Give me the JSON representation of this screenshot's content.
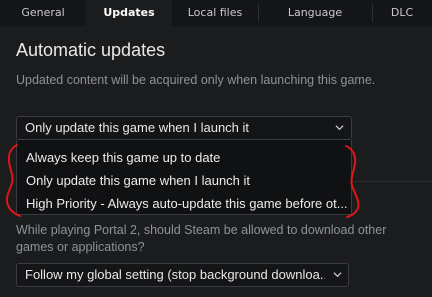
{
  "tabs": [
    {
      "label": "General"
    },
    {
      "label": "Updates"
    },
    {
      "label": "Local files"
    },
    {
      "label": "Language"
    },
    {
      "label": "DLC"
    }
  ],
  "auto_updates": {
    "heading": "Automatic updates",
    "description": "Updated content will be acquired only when launching this game.",
    "selected": "Only update this game when I launch it",
    "options": [
      "Always keep this game up to date",
      "Only update this game when I launch it",
      "High Priority - Always auto-update this game before ot..."
    ]
  },
  "background_downloads": {
    "question": "While playing Portal 2, should Steam be allowed to download other games or applications?",
    "selected": "Follow my global setting (stop background downloa..."
  },
  "colors": {
    "background": "#1b1c1e",
    "annotation": "#e0141a"
  },
  "icons": {
    "dropdown": "chevron-down-icon"
  }
}
